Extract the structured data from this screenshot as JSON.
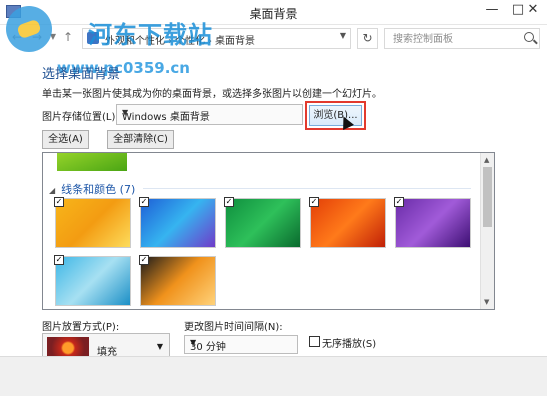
{
  "window": {
    "title": "桌面背景",
    "minimize_glyph": "—",
    "maximize_glyph": "□",
    "close_glyph": "✕"
  },
  "nav": {
    "back_glyph": "←",
    "forward_glyph": "→",
    "up_glyph": "↑",
    "breadcrumbs": [
      "外观和个性化",
      "个性化",
      "桌面背景"
    ],
    "crumb_separator": "›",
    "search_placeholder": "搜索控制面板"
  },
  "watermark": {
    "site_name": "河东下载站",
    "url": "www.pc0359.cn"
  },
  "header": {
    "title": "选择桌面背景",
    "description": "单击某一张图片使其成为你的桌面背景，或选择多张图片以创建一个幻灯片。"
  },
  "location": {
    "label": "图片存储位置(L):",
    "value": "Windows 桌面背景",
    "browse_label": "浏览(B)..."
  },
  "actions": {
    "select_all": "全选(A)",
    "clear_all": "全部清除(C)"
  },
  "gallery": {
    "group_title": "线条和颜色 (7)",
    "thumbnails": [
      {
        "name": "yellow-planes",
        "checked": true,
        "colors": [
          "#f8b51a",
          "#f39c12",
          "#fddc5c"
        ]
      },
      {
        "name": "blue-shards",
        "checked": true,
        "colors": [
          "#1e5fd6",
          "#36b4f0",
          "#6f3bc9"
        ]
      },
      {
        "name": "green-folds",
        "checked": true,
        "colors": [
          "#0f8f3e",
          "#2ec05a",
          "#0a6a2e"
        ]
      },
      {
        "name": "orange-waves",
        "checked": true,
        "colors": [
          "#e33f08",
          "#ff7a1a",
          "#c02007"
        ]
      },
      {
        "name": "purple-ribbons",
        "checked": true,
        "colors": [
          "#6a2ca8",
          "#a15bd9",
          "#3d0f73"
        ]
      },
      {
        "name": "cyan-lines",
        "checked": true,
        "colors": [
          "#3fb7e6",
          "#a7e0f2",
          "#1c8fc6"
        ]
      },
      {
        "name": "orange-city-bars",
        "checked": true,
        "colors": [
          "#1b1b1b",
          "#f0921c",
          "#ffd27a"
        ]
      }
    ],
    "check_glyph": "✓"
  },
  "bottom": {
    "fit_label": "图片放置方式(P):",
    "fit_value": "填充",
    "interval_label": "更改图片时间间隔(N):",
    "interval_value": "30 分钟",
    "shuffle_label": "无序播放(S)",
    "shuffle_checked": false
  }
}
